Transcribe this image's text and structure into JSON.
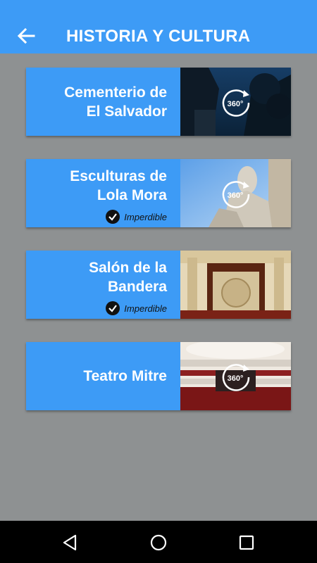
{
  "appbar": {
    "title": "HISTORIA Y CULTURA",
    "back_icon": "arrow-left-icon"
  },
  "cards": [
    {
      "title_line1": "Cementerio de",
      "title_line2": "El Salvador",
      "badge": "",
      "thumb_icon": "360-icon"
    },
    {
      "title_line1": "Esculturas de",
      "title_line2": "Lola Mora",
      "badge": "Imperdible",
      "thumb_icon": "360-icon"
    },
    {
      "title_line1": "Salón de la",
      "title_line2": "Bandera",
      "badge": "Imperdible",
      "thumb_icon": ""
    },
    {
      "title_line1": "Teatro Mitre",
      "title_line2": "",
      "badge": "",
      "thumb_icon": "360-icon"
    }
  ],
  "icon_labels": {
    "three_sixty": "360°"
  },
  "navbar": {
    "back": "nav-back-icon",
    "home": "nav-home-icon",
    "recents": "nav-recents-icon"
  },
  "colors": {
    "primary": "#3d9bf6",
    "background": "#8e9192",
    "navbar": "#000000"
  }
}
